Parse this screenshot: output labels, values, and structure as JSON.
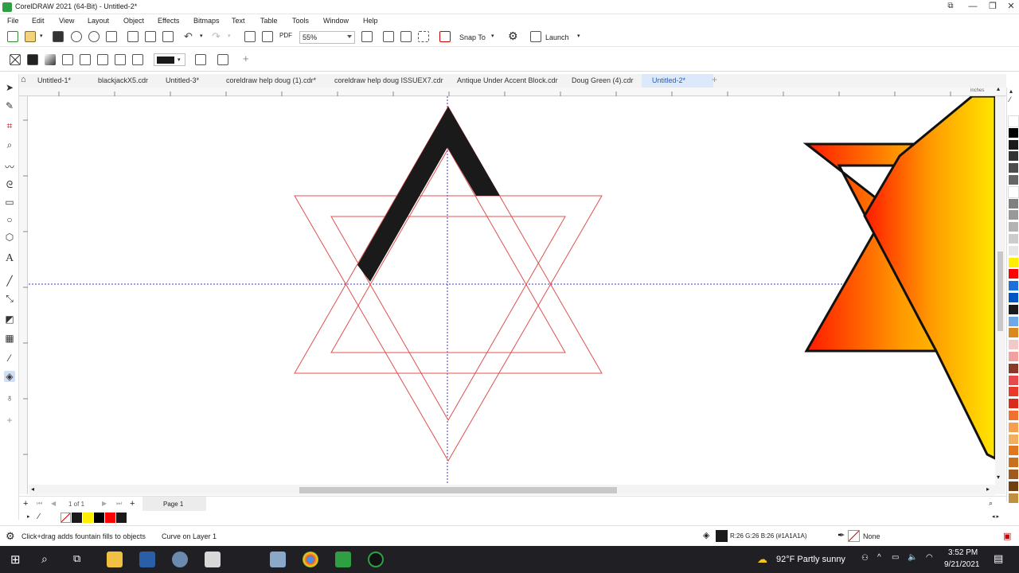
{
  "window": {
    "title": "CorelDRAW 2021 (64-Bit) - Untitled-2*",
    "controls": {
      "minimize": "—",
      "restore": "❐",
      "close": "✕"
    }
  },
  "menu": [
    "File",
    "Edit",
    "View",
    "Layout",
    "Object",
    "Effects",
    "Bitmaps",
    "Text",
    "Table",
    "Tools",
    "Window",
    "Help"
  ],
  "toolbar": {
    "zoom_value": "55%",
    "snap_label": "Snap To",
    "launch_label": "Launch",
    "pdf_label": "PDF"
  },
  "property_bar": {
    "fill_color": "#1a1a1a",
    "add_label": "+"
  },
  "tabs": {
    "home_label": "⌂",
    "items": [
      {
        "label": "Untitled-1*"
      },
      {
        "label": "blackjackX5.cdr"
      },
      {
        "label": "Untitled-3*"
      },
      {
        "label": "coreldraw help doug (1).cdr*"
      },
      {
        "label": "coreldraw help doug ISSUEX7.cdr"
      },
      {
        "label": "Antique Under Accent Block.cdr"
      },
      {
        "label": "Doug Green (4).cdr"
      },
      {
        "label": "Untitled-2*"
      }
    ],
    "add_label": "+"
  },
  "ruler": {
    "units": "inches"
  },
  "page_nav": {
    "page_count": "1 of 1",
    "page_tab": "Page 1"
  },
  "document_palette": {
    "colors": [
      "#1a1a1a",
      "#ffee00",
      "#000000",
      "#ff0000",
      "#1a1a1a"
    ]
  },
  "color_palette": [
    "#ffffff",
    "#000000",
    "#1a1a1a",
    "#333333",
    "#4d4d4d",
    "#666666",
    "#ffffff",
    "#808080",
    "#999999",
    "#b3b3b3",
    "#cccccc",
    "#e6e6e6",
    "#ffee00",
    "#ff0000",
    "#1e6fd9",
    "#0055c4",
    "#1a1a1a",
    "#6ea8e8",
    "#d98a1a",
    "#f2c9c9",
    "#f2a0a0",
    "#8b3a2a",
    "#e84a4a",
    "#e83a2a",
    "#d92a1a",
    "#f07030",
    "#f5a050",
    "#f0b060",
    "#e07820",
    "#c87020",
    "#a05a20",
    "#704010",
    "#c09040"
  ],
  "status": {
    "hint": "Click+drag adds fountain fills to objects",
    "layer_info": "Curve on Layer 1",
    "fill_info": "R:26 G:26 B:26 (#1A1A1A)",
    "outline_info": "None"
  },
  "taskbar": {
    "weather": "92°F  Partly sunny",
    "time": "3:52 PM",
    "date": "9/21/2021"
  }
}
